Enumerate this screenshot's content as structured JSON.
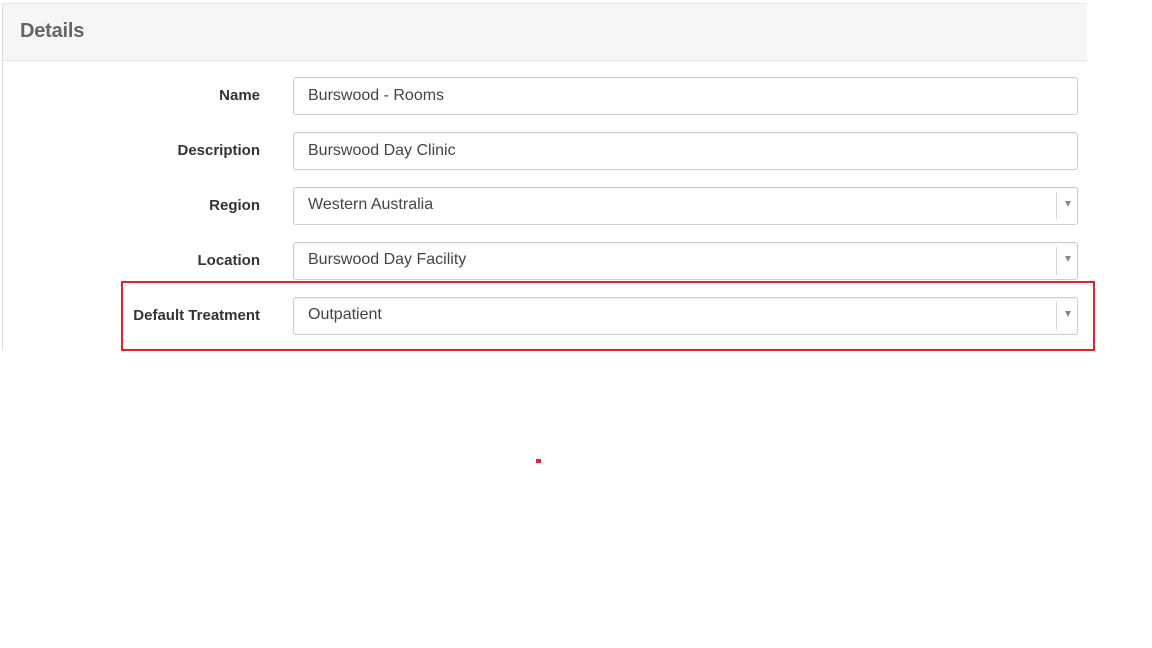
{
  "panel": {
    "title": "Details"
  },
  "form": {
    "name": {
      "label": "Name",
      "value": "Burswood - Rooms"
    },
    "description": {
      "label": "Description",
      "value": "Burswood Day Clinic"
    },
    "region": {
      "label": "Region",
      "value": "Western Australia"
    },
    "location": {
      "label": "Location",
      "value": "Burswood Day Facility"
    },
    "default_treatment": {
      "label": "Default Treatment",
      "value": "Outpatient"
    }
  },
  "icons": {
    "dropdown": "chevron-down-icon"
  },
  "colors": {
    "highlight": "#dd2230",
    "header_bg": "#f6f6f6",
    "title_text": "#666666"
  }
}
